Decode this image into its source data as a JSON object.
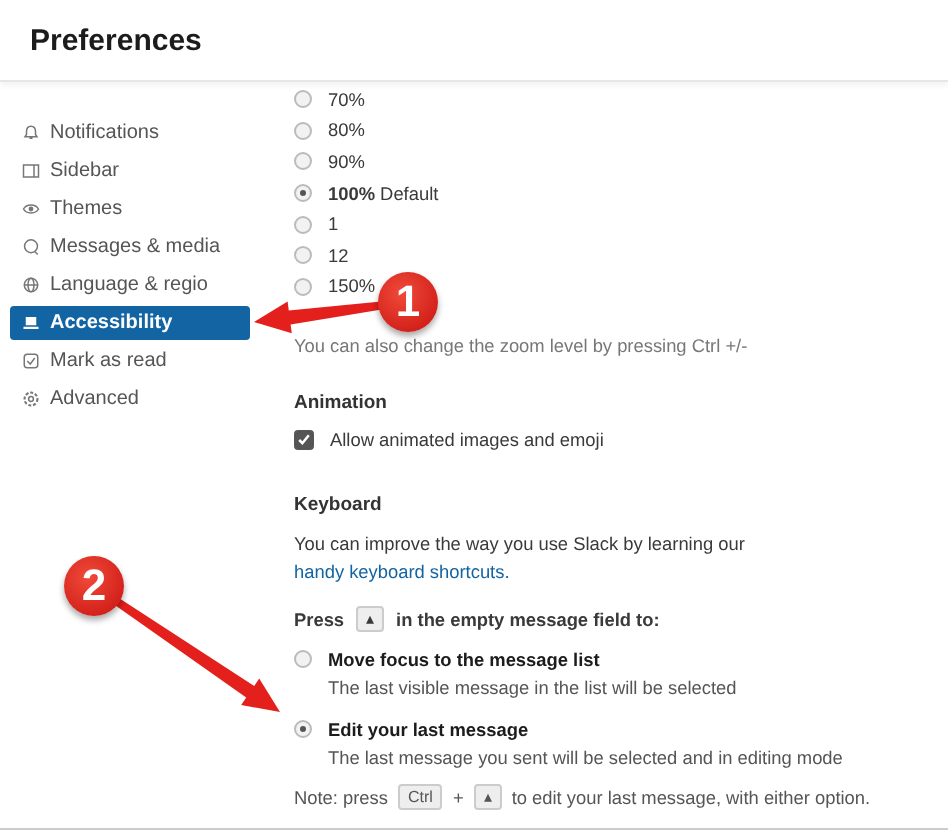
{
  "window": {
    "title": "Preferences"
  },
  "sidebar": {
    "items": [
      {
        "label": "Notifications",
        "selected": false
      },
      {
        "label": "Sidebar",
        "selected": false
      },
      {
        "label": "Themes",
        "selected": false
      },
      {
        "label": "Messages & media",
        "selected": false
      },
      {
        "label": "Language & regio",
        "selected": false
      },
      {
        "label": "Accessibility",
        "selected": true
      },
      {
        "label": "Mark as read",
        "selected": false
      },
      {
        "label": "Advanced",
        "selected": false
      }
    ]
  },
  "zoom": {
    "options": [
      {
        "label": "70%",
        "selected": false
      },
      {
        "label": "80%",
        "selected": false
      },
      {
        "label": "90%",
        "selected": false
      },
      {
        "label": "**100%** Default",
        "selected": true
      },
      {
        "label": "1",
        "selected": false
      },
      {
        "label": "12",
        "selected": false
      },
      {
        "label": "150%",
        "selected": false
      }
    ],
    "hint": "You can also change the zoom level by pressing Ctrl +/-"
  },
  "animation": {
    "heading": "Animation",
    "checkbox": {
      "label": "Allow animated images and emoji",
      "checked": true
    }
  },
  "keyboard": {
    "heading": "Keyboard",
    "description": "You can improve the way you use Slack by learning our",
    "link": "handy keyboard shortcuts.",
    "press_label": "Press",
    "press_key": "▴",
    "press_suffix": "in the empty message field to:",
    "options": [
      {
        "title": "Move focus to the message list",
        "description": "The last visible message in the list will be selected",
        "selected": false
      },
      {
        "title": "Edit your last message",
        "description": "The last message you sent will be selected and in editing mode",
        "selected": true
      }
    ],
    "note": {
      "prefix": "Note: press",
      "key_1": "Ctrl",
      "plus": "+",
      "key_2": "▴",
      "suffix": "to edit your last message, with either option."
    }
  },
  "callouts": [
    {
      "number": "1"
    },
    {
      "number": "2"
    }
  ]
}
